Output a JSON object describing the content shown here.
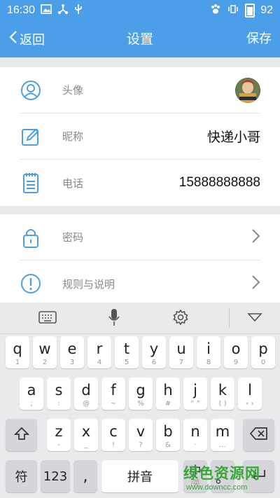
{
  "status_bar": {
    "time": "16:30",
    "battery_level": "92"
  },
  "nav": {
    "back_label": "返回",
    "title": "设置",
    "save_label": "保存"
  },
  "profile": {
    "avatar_label": "头像",
    "nickname_label": "昵称",
    "nickname_value": "快递小哥",
    "phone_label": "电话",
    "phone_value": "15888888888"
  },
  "settings": {
    "password_label": "密码",
    "rules_label": "规则与说明"
  },
  "keyboard": {
    "row1": [
      {
        "main": "q",
        "sub": "1"
      },
      {
        "main": "w",
        "sub": "2"
      },
      {
        "main": "e",
        "sub": "3"
      },
      {
        "main": "r",
        "sub": "4"
      },
      {
        "main": "t",
        "sub": "5"
      },
      {
        "main": "y",
        "sub": "6"
      },
      {
        "main": "u",
        "sub": "7"
      },
      {
        "main": "i",
        "sub": "8"
      },
      {
        "main": "o",
        "sub": "9"
      },
      {
        "main": "p",
        "sub": "0"
      }
    ],
    "row2": [
      {
        "main": "a",
        "sub": ";"
      },
      {
        "main": "s",
        "sub": ":"
      },
      {
        "main": "d",
        "sub": "@"
      },
      {
        "main": "f",
        "sub": "~"
      },
      {
        "main": "g",
        "sub": "%"
      },
      {
        "main": "h",
        "sub": "#"
      },
      {
        "main": "j",
        "sub": "“ ”"
      },
      {
        "main": "k",
        "sub": "( )"
      },
      {
        "main": "l",
        "sub": "‹ ›"
      }
    ],
    "row3": [
      {
        "main": "z",
        "sub": "-"
      },
      {
        "main": "x",
        "sub": "_"
      },
      {
        "main": "c",
        "sub": "!"
      },
      {
        "main": "v",
        "sub": "?"
      },
      {
        "main": "b",
        "sub": "&"
      },
      {
        "main": "n",
        "sub": "·"
      },
      {
        "main": "m",
        "sub": "…"
      }
    ],
    "symbols_label": "符",
    "numbers_label": "123",
    "comma_label": ",",
    "space_label": "拼音",
    "lang_label": "中",
    "lang_sub": "/英"
  },
  "watermark": {
    "line1": "绿色资源网",
    "line2": "www.downcc.com"
  },
  "colors": {
    "accent": "#4b9fe8",
    "icon": "#4b9fe8"
  }
}
